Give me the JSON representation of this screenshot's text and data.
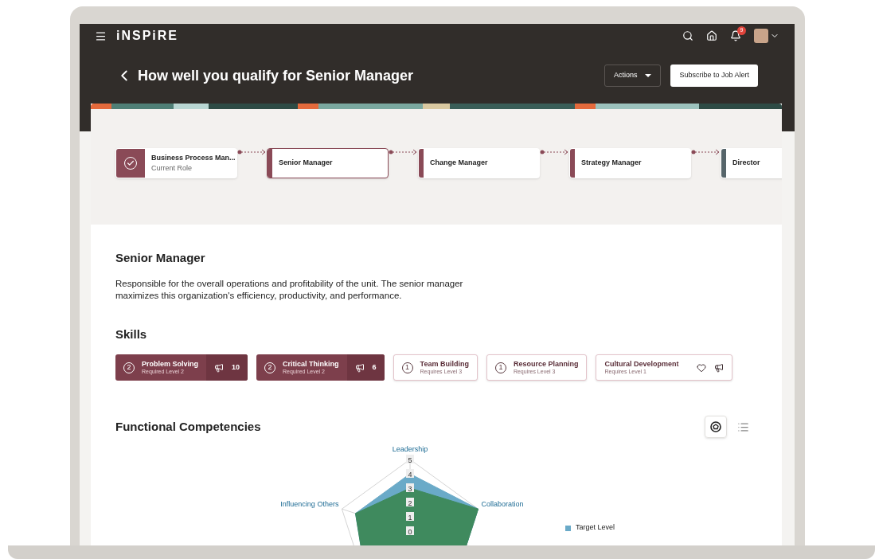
{
  "app": {
    "logo": "iNSPiRE",
    "notifications": "9"
  },
  "header": {
    "title": "How well you qualify for Senior Manager",
    "actions_button": "Actions",
    "subscribe_button": "Subscribe to Job Alert"
  },
  "career_path": [
    {
      "title": "Business Process Man...",
      "subtitle": "Current Role",
      "completed": true,
      "selected": false,
      "color": "#8a4a57"
    },
    {
      "title": "Senior Manager",
      "completed": false,
      "selected": true,
      "color": "#8a4a57"
    },
    {
      "title": "Change Manager",
      "completed": false,
      "selected": false,
      "color": "#8a4a57"
    },
    {
      "title": "Strategy Manager",
      "completed": false,
      "selected": false,
      "color": "#8a4a57"
    },
    {
      "title": "Director",
      "completed": false,
      "selected": false,
      "color": "#56656a"
    }
  ],
  "role": {
    "title": "Senior Manager",
    "description": "Responsible for the overall operations and profitability of the unit. The senior manager maximizes this organization's efficiency, productivity, and performance."
  },
  "skills": {
    "title": "Skills",
    "items": [
      {
        "kind": "earned",
        "name": "Problem Solving",
        "requirement": "Required Level 2",
        "badge": "2",
        "count": "10"
      },
      {
        "kind": "earned",
        "name": "Critical Thinking",
        "requirement": "Required Level 2",
        "badge": "2",
        "count": "6"
      },
      {
        "kind": "required",
        "name": "Team Building",
        "requirement": "Requires Level 3",
        "badge": "1"
      },
      {
        "kind": "required",
        "name": "Resource Planning",
        "requirement": "Requires Level 3",
        "badge": "1"
      },
      {
        "kind": "interest",
        "name": "Cultural Development",
        "requirement": "Requires Level 1"
      }
    ]
  },
  "competencies": {
    "title": "Functional Competencies",
    "views": [
      {
        "kind": "radar",
        "selected": true
      },
      {
        "kind": "list",
        "selected": false
      }
    ],
    "radar": {
      "axes": [
        "Leadership",
        "Collaboration",
        "Influencing Others"
      ],
      "ticks": [
        "5",
        "4",
        "3",
        "2",
        "1",
        "0"
      ],
      "series": [
        {
          "name": "Target Level",
          "color": "#6aaac8"
        },
        {
          "color": "#3f8a5e"
        }
      ]
    }
  }
}
